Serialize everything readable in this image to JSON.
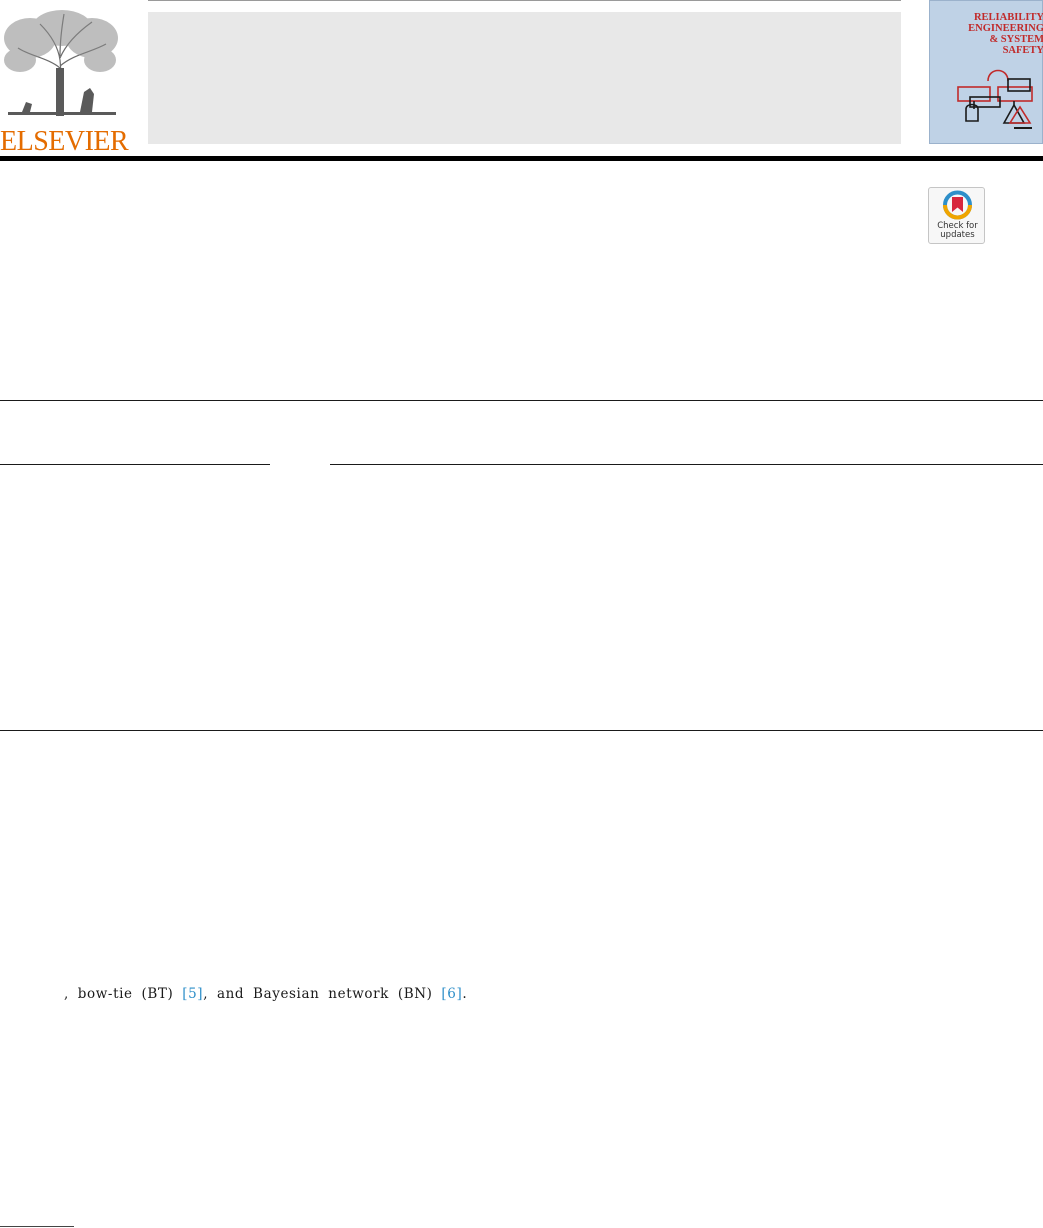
{
  "masthead": {
    "publisher": "ELSEVIER",
    "journal_cover_title": "RELIABILITY\nENGINEERING\n& SYSTEM\nSAFETY"
  },
  "check_updates": {
    "label": "Check for\nupdates",
    "icon": "check-for-updates-icon"
  },
  "body": {
    "text_before": ", bow-tie (BT) ",
    "ref_5": "[5]",
    "text_middle": ", and Bayesian network (BN) ",
    "ref_6": "[6]",
    "text_after": "."
  },
  "colors": {
    "publisher_orange": "#e46c00",
    "cover_red": "#c12a2a",
    "link_blue": "#2e8fc9"
  }
}
